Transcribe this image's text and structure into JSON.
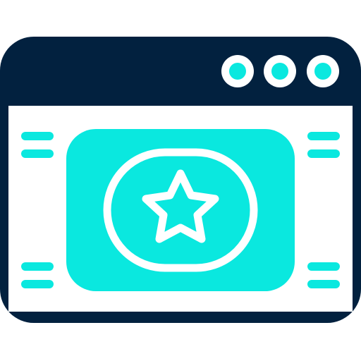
{
  "icon": {
    "subject": "browser-window-with-featured-star-banner",
    "colors": {
      "frame": "#02213f",
      "accent": "#0ae8df",
      "inner": "#ffffff"
    },
    "window_buttons": [
      "circle-button",
      "circle-button",
      "circle-button"
    ],
    "banner_icon": "star-icon",
    "side_lines": [
      "text-line",
      "text-line",
      "text-line",
      "text-line",
      "text-line",
      "text-line",
      "text-line",
      "text-line"
    ]
  }
}
